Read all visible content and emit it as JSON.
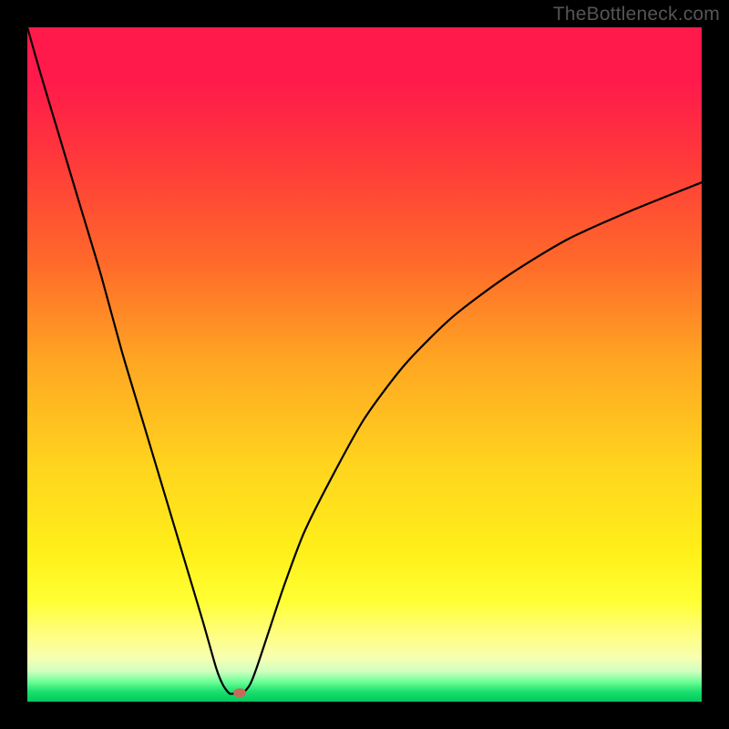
{
  "watermark": "TheBottleneck.com",
  "chart_data": {
    "type": "line",
    "title": "",
    "xlabel": "",
    "ylabel": "",
    "xlim": [
      0,
      100
    ],
    "ylim": [
      0,
      100
    ],
    "series": [
      {
        "name": "bottleneck-curve",
        "x": [
          0,
          2,
          5,
          8,
          11,
          14,
          17,
          20,
          23,
          26,
          28,
          29,
          30,
          31,
          31.5,
          32,
          33,
          34,
          36,
          38,
          41,
          45,
          50,
          56,
          63,
          71,
          80,
          90,
          100
        ],
        "y": [
          100,
          93,
          83,
          73,
          63,
          52,
          42,
          32,
          22,
          12,
          5,
          2.5,
          1.2,
          1.3,
          1.3,
          1.3,
          2.5,
          5,
          11,
          17,
          25,
          33,
          42,
          50,
          57,
          63,
          68.5,
          73,
          77
        ]
      }
    ],
    "marker": {
      "name": "optimal-point",
      "x": 31.5,
      "y": 1.3,
      "color": "#c66a5a",
      "rx": 7,
      "ry": 5
    },
    "background": "rainbow-vertical-gradient"
  }
}
